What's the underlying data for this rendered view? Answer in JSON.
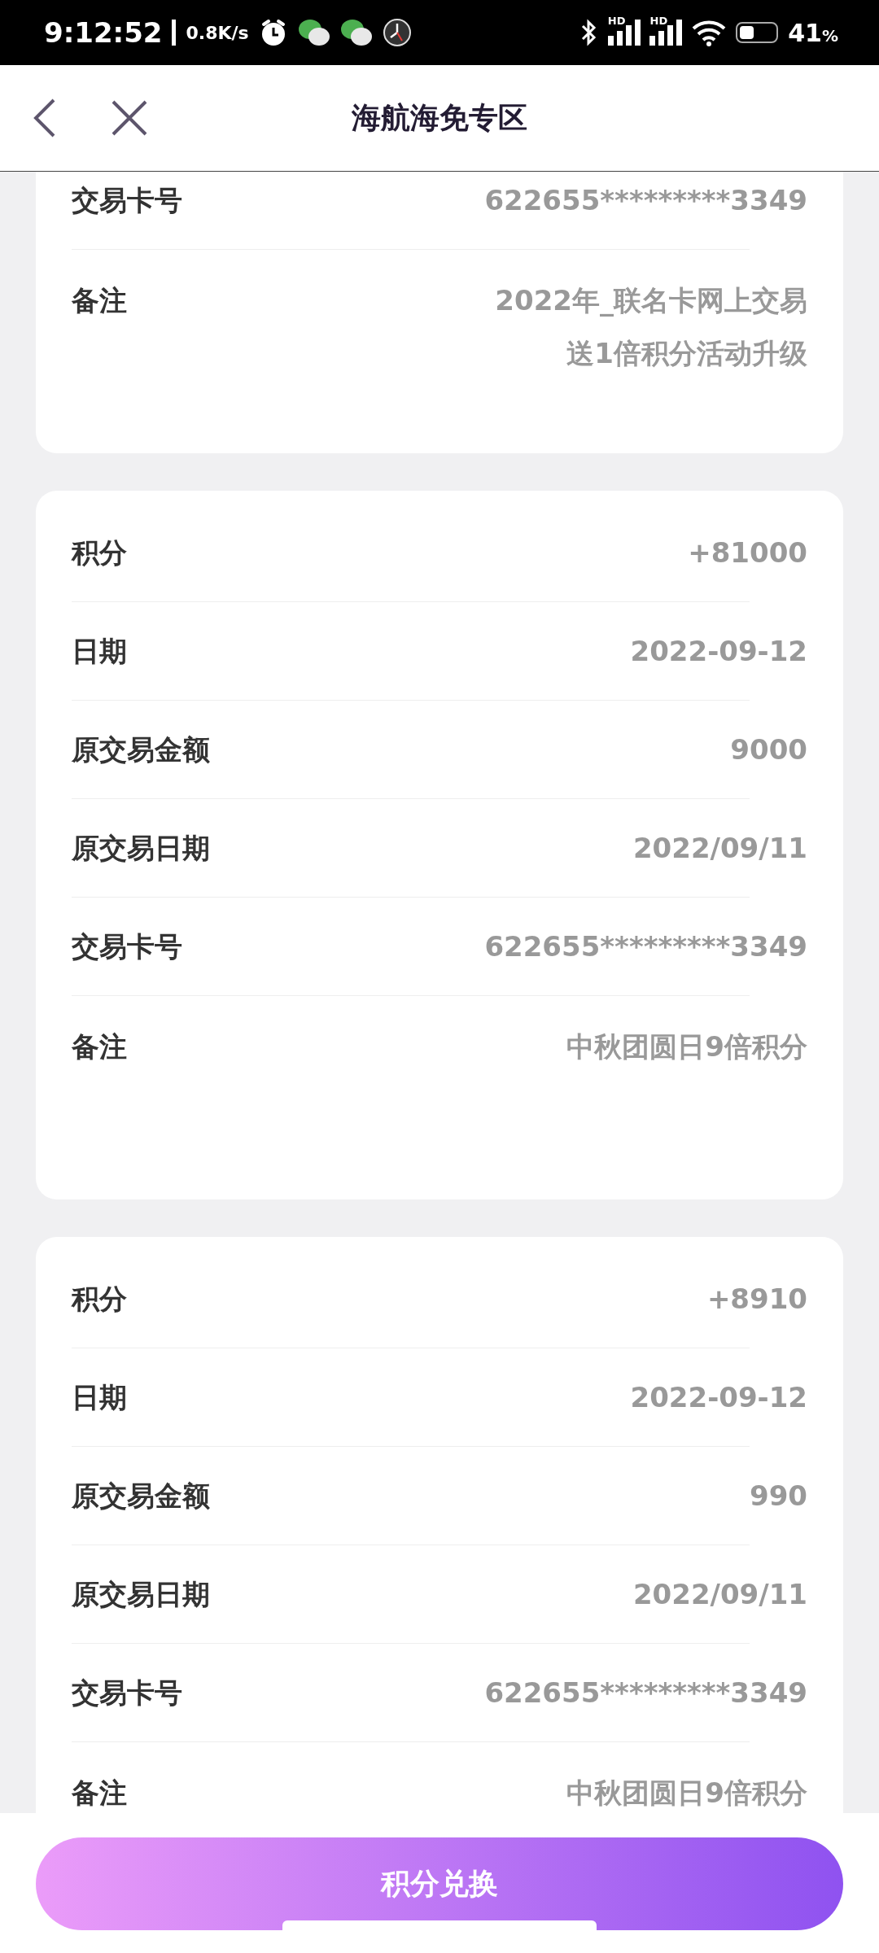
{
  "status_bar": {
    "time": "9:12:52",
    "speed": "0.8K/s",
    "signal_labels": [
      "HD",
      "HD"
    ],
    "battery": "41",
    "battery_unit": "%"
  },
  "header": {
    "title": "海航海免专区"
  },
  "records": [
    {
      "fields": [
        {
          "label": "交易卡号",
          "value": "622655*********3349"
        },
        {
          "label": "备注",
          "value_lines": [
            "2022年_联名卡网上交易",
            "送1倍积分活动升级"
          ],
          "kind": "remark"
        }
      ]
    },
    {
      "fields": [
        {
          "label": "积分",
          "value": "+81000"
        },
        {
          "label": "日期",
          "value": "2022-09-12"
        },
        {
          "label": "原交易金额",
          "value": "9000"
        },
        {
          "label": "原交易日期",
          "value": "2022/09/11"
        },
        {
          "label": "交易卡号",
          "value": "622655*********3349"
        },
        {
          "label": "备注",
          "value": "中秋团圆日9倍积分",
          "kind": "remark"
        }
      ]
    },
    {
      "fields": [
        {
          "label": "积分",
          "value": "+8910"
        },
        {
          "label": "日期",
          "value": "2022-09-12"
        },
        {
          "label": "原交易金额",
          "value": "990"
        },
        {
          "label": "原交易日期",
          "value": "2022/09/11"
        },
        {
          "label": "交易卡号",
          "value": "622655*********3349"
        },
        {
          "label": "备注",
          "value": "中秋团圆日9倍积分",
          "kind": "remark"
        }
      ]
    }
  ],
  "action_button": {
    "label": "积分兑换"
  }
}
